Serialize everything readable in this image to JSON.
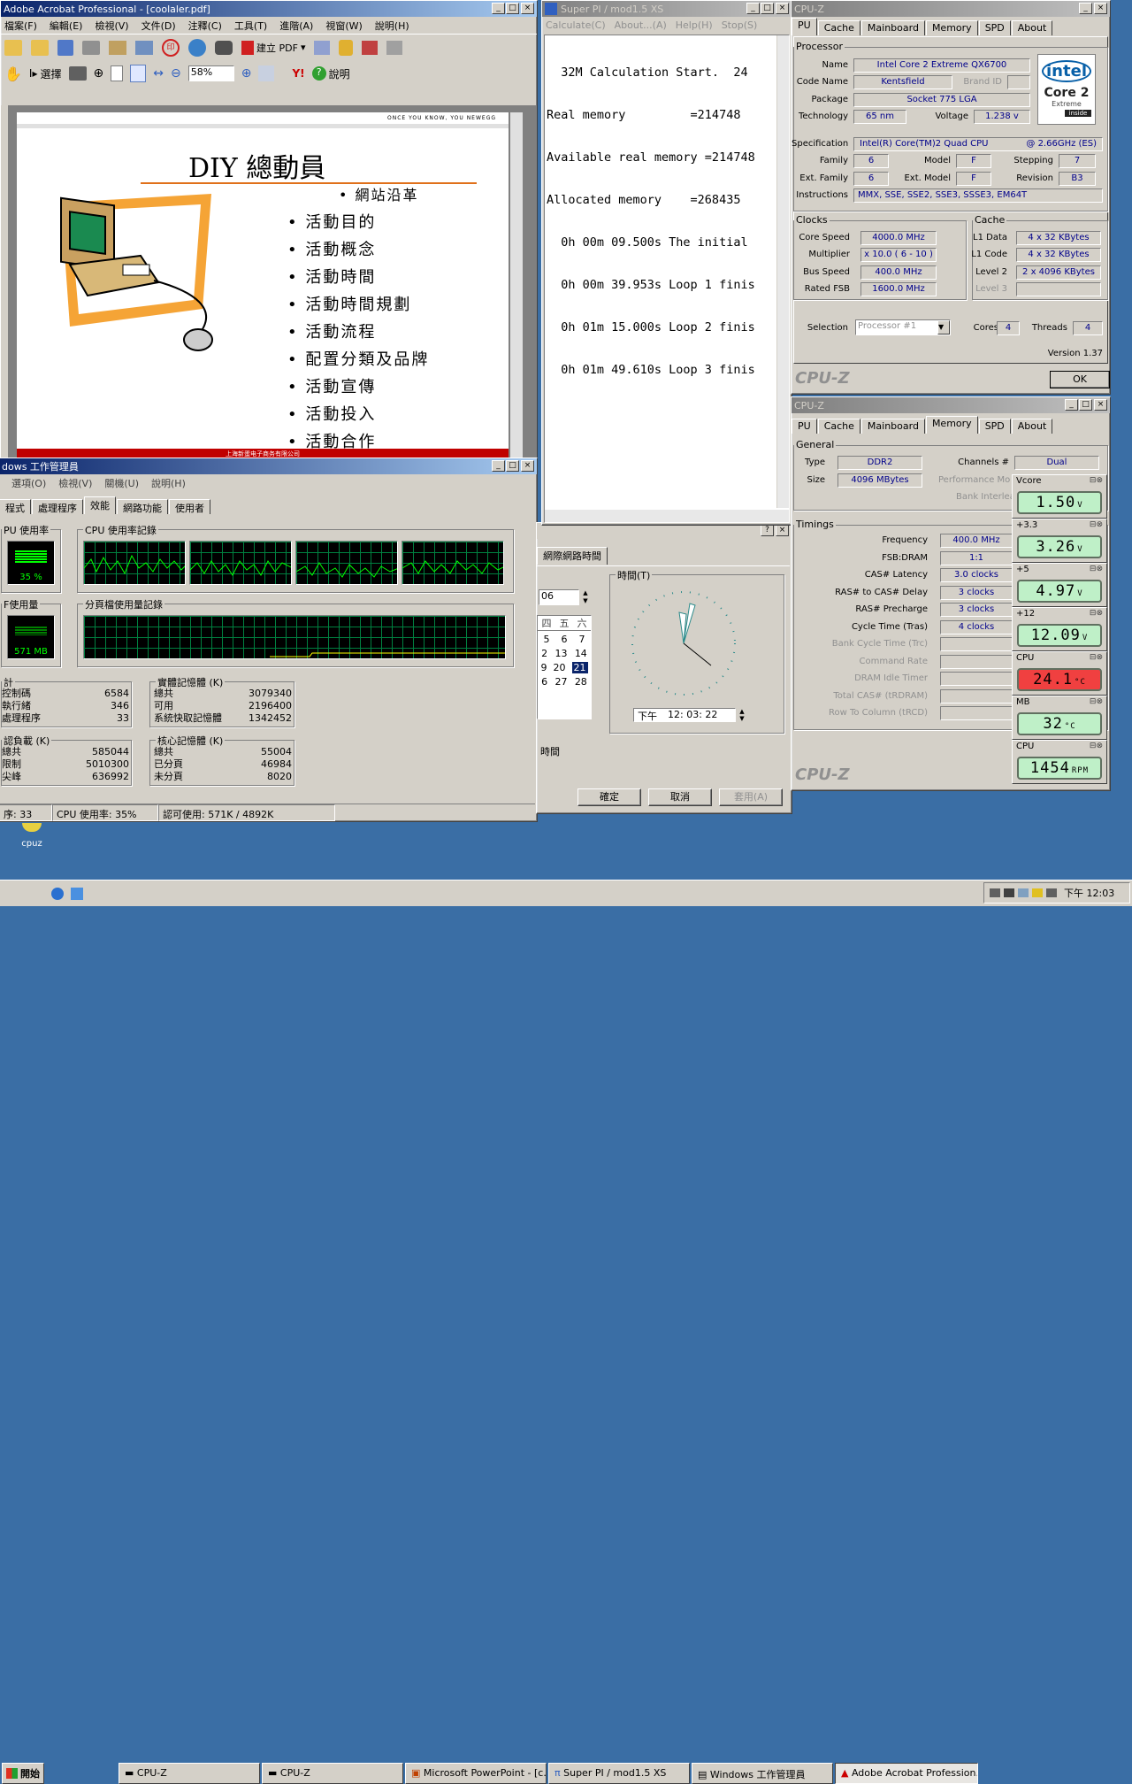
{
  "acrobat": {
    "title": "Adobe Acrobat Professional - [coolaler.pdf]",
    "menu": [
      "檔案(F)",
      "編輯(E)",
      "檢視(V)",
      "文件(D)",
      "注釋(C)",
      "工具(T)",
      "進階(A)",
      "視窗(W)",
      "說明(H)"
    ],
    "create_pdf": "建立 PDF",
    "select": "選擇",
    "zoom": "58%",
    "help": "說明",
    "slide": {
      "header": "ONCE YOU KNOW, YOU NEWEGG",
      "title": "DIY 總動員",
      "items": [
        "網站沿革",
        "活動目的",
        "活動概念",
        "活動時間",
        "活動時間規劃",
        "活動流程",
        "配置分類及品牌",
        "活動宣傳",
        "活動投入",
        "活動合作"
      ],
      "footer": "上海新蛋电子商务有限公司"
    }
  },
  "superpi": {
    "title": "Super PI / mod1.5 XS",
    "menu": [
      "Calculate(C)",
      "About...(A)",
      "Help(H)",
      "Stop(S)"
    ],
    "lines": [
      "  32M Calculation Start.  24",
      "Real memory         =214748",
      "Available real memory =214748",
      "Allocated memory    =268435",
      "  0h 00m 09.500s The initial",
      "  0h 00m 39.953s Loop 1 finis",
      "  0h 01m 15.000s Loop 2 finis",
      "  0h 01m 49.610s Loop 3 finis"
    ]
  },
  "datetime": {
    "tab": "網際網路時間",
    "time_label": "時間(T)",
    "year": "06",
    "days_header": [
      "四",
      "五",
      "六"
    ],
    "days": [
      [
        "5",
        "6",
        "7"
      ],
      [
        "2",
        "13",
        "14"
      ],
      [
        "9",
        "20",
        "21"
      ],
      [
        "6",
        "27",
        "28"
      ]
    ],
    "selected_day": "21",
    "ampm": "下午",
    "time": "12: 03: 22",
    "tz_label": "時間",
    "ok": "確定",
    "cancel": "取消",
    "apply": "套用(A)"
  },
  "taskmgr": {
    "title": "dows 工作管理員",
    "menu": [
      "選項(O)",
      "檢視(V)",
      "關機(U)",
      "說明(H)"
    ],
    "tabs": [
      "程式",
      "處理程序",
      "效能",
      "網路功能",
      "使用者"
    ],
    "cpu_usage_title": "PU 使用率",
    "cpu_usage": "35 %",
    "cpu_history_title": "CPU 使用率記錄",
    "pf_title": "F使用量",
    "pf_value": "571 MB",
    "pf_history_title": "分頁檔使用量記錄",
    "totals_title": "計",
    "totals": [
      [
        "控制碼",
        "6584"
      ],
      [
        "執行緒",
        "346"
      ],
      [
        "處理程序",
        "33"
      ]
    ],
    "phys_title": "實體記憶體 (K)",
    "phys": [
      [
        "總共",
        "3079340"
      ],
      [
        "可用",
        "2196400"
      ],
      [
        "系統快取記憶體",
        "1342452"
      ]
    ],
    "commit_title": "認負載 (K)",
    "commit": [
      [
        "總共",
        "585044"
      ],
      [
        "限制",
        "5010300"
      ],
      [
        "尖峰",
        "636992"
      ]
    ],
    "kernel_title": "核心記憶體 (K)",
    "kernel": [
      [
        "總共",
        "55004"
      ],
      [
        "已分頁",
        "46984"
      ],
      [
        "未分頁",
        "8020"
      ]
    ],
    "status": [
      "序: 33",
      "CPU 使用率: 35%",
      "認可使用: 571K / 4892K"
    ]
  },
  "cpuz1": {
    "title": "CPU-Z",
    "tabs": [
      "PU",
      "Cache",
      "Mainboard",
      "Memory",
      "SPD",
      "About"
    ],
    "processor": "Processor",
    "name": "Intel Core 2 Extreme QX6700",
    "code_name": "Kentsfield",
    "brand_id": "Brand ID",
    "package": "Socket 775 LGA",
    "technology": "65 nm",
    "voltage": "1.238 v",
    "specification": "Intel(R) Core(TM)2 Quad CPU",
    "spec_speed": "@ 2.66GHz (ES)",
    "family": "6",
    "model": "F",
    "stepping": "7",
    "ext_family": "6",
    "ext_model": "F",
    "revision": "B3",
    "instructions": "MMX, SSE, SSE2, SSE3, SSSE3, EM64T",
    "labels": {
      "name": "Name",
      "code_name": "Code Name",
      "package": "Package",
      "technology": "Technology",
      "voltage": "Voltage",
      "specification": "Specification",
      "family": "Family",
      "model": "Model",
      "stepping": "Stepping",
      "ext_family": "Ext. Family",
      "ext_model": "Ext. Model",
      "revision": "Revision",
      "instructions": "Instructions",
      "clocks": "Clocks",
      "core_speed": "Core Speed",
      "multiplier": "Multiplier",
      "bus_speed": "Bus Speed",
      "rated_fsb": "Rated FSB",
      "cache": "Cache",
      "l1d": "L1 Data",
      "l1c": "L1 Code",
      "l2": "Level 2",
      "l3": "Level 3",
      "selection": "Selection",
      "cores": "Cores",
      "threads": "Threads"
    },
    "core_speed": "4000.0 MHz",
    "multiplier": "x 10.0 ( 6 - 10 )",
    "bus_speed": "400.0 MHz",
    "rated_fsb": "1600.0 MHz",
    "l1d": "4 x 32 KBytes",
    "l1c": "4 x 32 KBytes",
    "l2": "2 x 4096 KBytes",
    "selection": "Processor #1",
    "cores": "4",
    "threads": "4",
    "version": "Version 1.37",
    "footer": "CPU-Z",
    "ok": "OK",
    "logo_brand": "intel",
    "logo_core": "Core 2",
    "logo_sub": "Extreme",
    "logo_inside": "inside"
  },
  "cpuz2": {
    "title": "CPU-Z",
    "tabs": [
      "PU",
      "Cache",
      "Mainboard",
      "Memory",
      "SPD",
      "About"
    ],
    "general": "General",
    "type_label": "Type",
    "type": "DDR2",
    "size_label": "Size",
    "size": "4096 MBytes",
    "channels_label": "Channels #",
    "channels": "Dual",
    "perf_mode": "Performance Mo",
    "bank_il": "Bank Interlea",
    "timings": "Timings",
    "rows": [
      [
        "Frequency",
        "400.0 MHz",
        false
      ],
      [
        "FSB:DRAM",
        "1:1",
        false
      ],
      [
        "CAS# Latency",
        "3.0 clocks",
        false
      ],
      [
        "RAS# to CAS# Delay",
        "3 clocks",
        false
      ],
      [
        "RAS# Precharge",
        "3 clocks",
        false
      ],
      [
        "Cycle Time (Tras)",
        "4 clocks",
        false
      ],
      [
        "Bank Cycle Time (Trc)",
        "",
        true
      ],
      [
        "Command Rate",
        "",
        true
      ],
      [
        "DRAM Idle Timer",
        "",
        true
      ],
      [
        "Total CAS# (tRDRAM)",
        "",
        true
      ],
      [
        "Row To Column (tRCD)",
        "",
        true
      ]
    ],
    "footer": "CPU-Z"
  },
  "sensors": [
    {
      "label": "Vcore",
      "value": "1.50",
      "unit": "V",
      "color": "#bff0c8"
    },
    {
      "label": "+3.3",
      "value": "3.26",
      "unit": "V",
      "color": "#bff0c8"
    },
    {
      "label": "+5",
      "value": "4.97",
      "unit": "V",
      "color": "#bff0c8"
    },
    {
      "label": "+12",
      "value": "12.09",
      "unit": "V",
      "color": "#bff0c8"
    },
    {
      "label": "CPU",
      "value": "24.1",
      "unit": "°C",
      "color": "#f04040"
    },
    {
      "label": "MB",
      "value": "32",
      "unit": "°C",
      "color": "#bff0c8"
    },
    {
      "label": "CPU",
      "value": "1454",
      "unit": "RPM",
      "color": "#bff0c8"
    }
  ],
  "desktop": {
    "icon_label": "cpuz"
  },
  "taskbar": {
    "start": "開始",
    "items": [
      "CPU-Z",
      "CPU-Z",
      "Microsoft PowerPoint - [c...",
      "Super PI / mod1.5 XS",
      "Windows 工作管理員",
      "Adobe Acrobat Profession..."
    ],
    "clock": "下午 12:03"
  }
}
